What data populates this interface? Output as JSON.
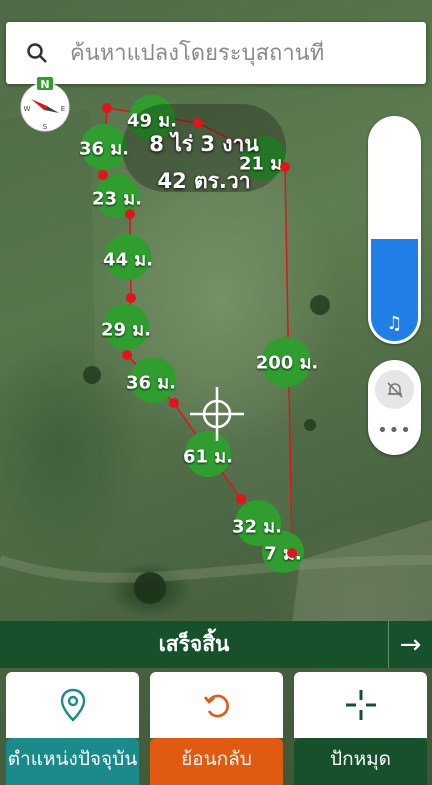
{
  "search": {
    "placeholder": "ค้นหาแปลงโดยระบุสถานที่"
  },
  "compass": {
    "north": "N",
    "east": "E",
    "south": "S",
    "west": "W"
  },
  "area": {
    "line1": "8 ไร่ 3 งาน",
    "line2": "42 ตร.วา"
  },
  "segments": [
    {
      "label": "49 ม."
    },
    {
      "label": "36 ม."
    },
    {
      "label": "21 ม."
    },
    {
      "label": "23 ม."
    },
    {
      "label": "44 ม."
    },
    {
      "label": "29 ม."
    },
    {
      "label": "36 ม."
    },
    {
      "label": "200 ม."
    },
    {
      "label": "61 ม."
    },
    {
      "label": "32 ม."
    },
    {
      "label": "7 ม."
    }
  ],
  "slider": {
    "level": 0.46,
    "icon": "music-note-icon"
  },
  "side_controls": {
    "bell_icon": "bell-off-icon",
    "more_icon": "more-dots-icon"
  },
  "finish": {
    "label": "เสร็จสิ้น",
    "icon": "arrow-right-icon"
  },
  "actions": [
    {
      "label": "ตำแหน่งปัจจุบัน",
      "icon": "location-pin-icon",
      "color": "#1a8a8a"
    },
    {
      "label": "ย้อนกลับ",
      "icon": "undo-icon",
      "color": "#e05a12"
    },
    {
      "label": "ปักหมุด",
      "icon": "crosshair-plus-icon",
      "color": "#17512c"
    }
  ],
  "colors": {
    "accent_green": "#2f9e2f",
    "boundary_red": "#e0141c",
    "dark_green": "#17512c"
  }
}
